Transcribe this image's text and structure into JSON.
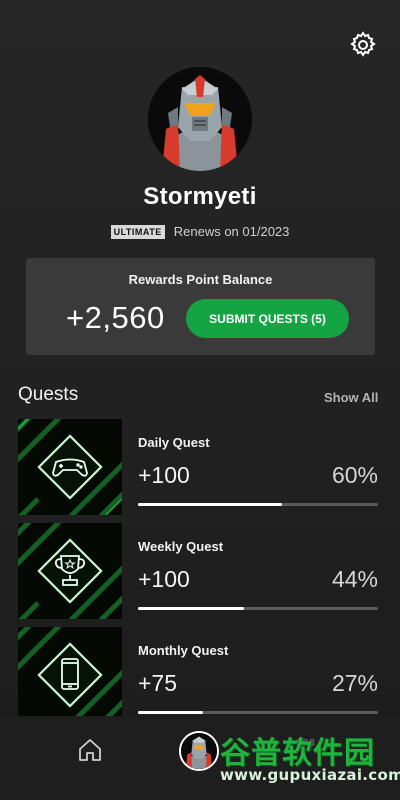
{
  "profile": {
    "username": "Stormyeti",
    "tier_badge": "ULTIMATE",
    "renewal_text": "Renews on 01/2023",
    "avatar_icon": "robot-avatar-icon"
  },
  "rewards": {
    "title": "Rewards Point Balance",
    "balance": "+2,560",
    "submit_label": "SUBMIT QUESTS (5)"
  },
  "quests": {
    "header": "Quests",
    "show_all_label": "Show All",
    "items": [
      {
        "name": "Daily Quest",
        "points": "+100",
        "percent_label": "60%",
        "progress": 0.6,
        "icon": "gamepad-icon"
      },
      {
        "name": "Weekly Quest",
        "points": "+100",
        "percent_label": "44%",
        "progress": 0.44,
        "icon": "trophy-icon"
      },
      {
        "name": "Monthly Quest",
        "points": "+75",
        "percent_label": "27%",
        "progress": 0.27,
        "icon": "phone-icon"
      }
    ]
  },
  "nav": {
    "home_icon": "home-icon",
    "profile_icon": "avatar-icon",
    "third_label": "888"
  },
  "watermark": {
    "logo_text": "谷普软件园",
    "url": "www.gupuxiazai.com"
  },
  "colors": {
    "accent_green": "#14a443",
    "card_bg": "#3a3a3a",
    "background": "#222222"
  }
}
